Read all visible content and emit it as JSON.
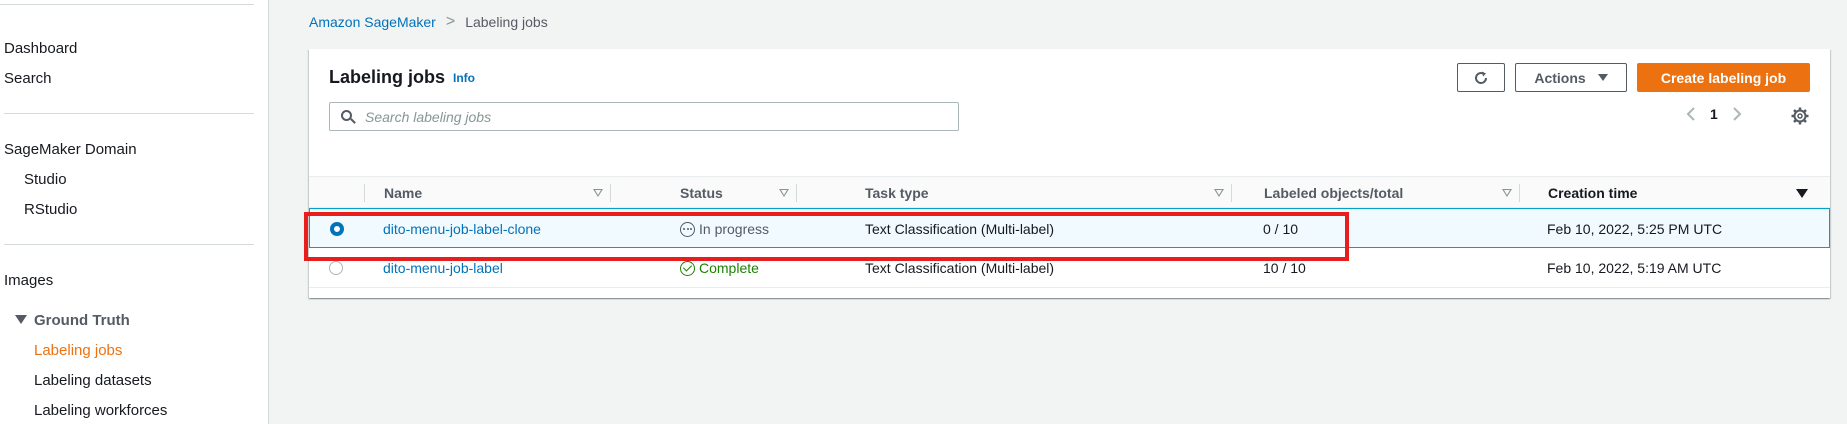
{
  "sidebar": {
    "top_items": [
      "Dashboard",
      "Search"
    ],
    "domain_heading": "SageMaker Domain",
    "domain_items": [
      "Studio",
      "RStudio"
    ],
    "images_label": "Images",
    "group_label": "Ground Truth",
    "group_items": [
      {
        "label": "Labeling jobs",
        "active": true
      },
      {
        "label": "Labeling datasets",
        "active": false
      },
      {
        "label": "Labeling workforces",
        "active": false
      }
    ]
  },
  "breadcrumb": {
    "root": "Amazon SageMaker",
    "separator": ">",
    "current": "Labeling jobs"
  },
  "panel": {
    "title": "Labeling jobs",
    "info": "Info",
    "search_placeholder": "Search labeling jobs",
    "actions_label": "Actions",
    "create_label": "Create labeling job",
    "page_number": "1"
  },
  "table": {
    "columns": [
      "Name",
      "Status",
      "Task type",
      "Labeled objects/total",
      "Creation time"
    ],
    "sorted_column": "Creation time",
    "rows": [
      {
        "selected": true,
        "name": "dito-menu-job-label-clone",
        "status": "In progress",
        "status_icon": "in-progress-icon",
        "task_type": "Text Classification (Multi-label)",
        "labeled": "0 / 10",
        "created": "Feb 10, 2022, 5:25 PM UTC"
      },
      {
        "selected": false,
        "name": "dito-menu-job-label",
        "status": "Complete",
        "status_icon": "success-check-icon",
        "task_type": "Text Classification (Multi-label)",
        "labeled": "10 / 10",
        "created": "Feb 10, 2022, 5:19 AM UTC"
      }
    ]
  },
  "colors": {
    "accent": "#ec7211",
    "link": "#0073bb",
    "success": "#1d8102",
    "highlight_annotation": "#e81d1d"
  }
}
